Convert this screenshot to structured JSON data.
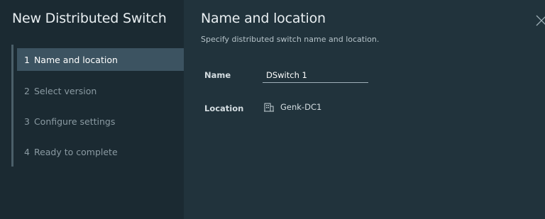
{
  "wizard": {
    "title": "New Distributed Switch"
  },
  "steps": [
    {
      "num": "1",
      "label": "Name and location",
      "active": true
    },
    {
      "num": "2",
      "label": "Select version",
      "active": false
    },
    {
      "num": "3",
      "label": "Configure settings",
      "active": false
    },
    {
      "num": "4",
      "label": "Ready to complete",
      "active": false
    }
  ],
  "page": {
    "title": "Name and location",
    "subtitle": "Specify distributed switch name and location."
  },
  "form": {
    "name_label": "Name",
    "name_value": "DSwitch 1",
    "location_label": "Location",
    "location_value": "Genk-DC1",
    "location_icon": "datacenter-icon"
  },
  "icons": {
    "close": "close-icon"
  },
  "colors": {
    "sidebar_bg": "#1b2a32",
    "main_bg": "#21333c",
    "active_step_bg": "#3c5361"
  }
}
